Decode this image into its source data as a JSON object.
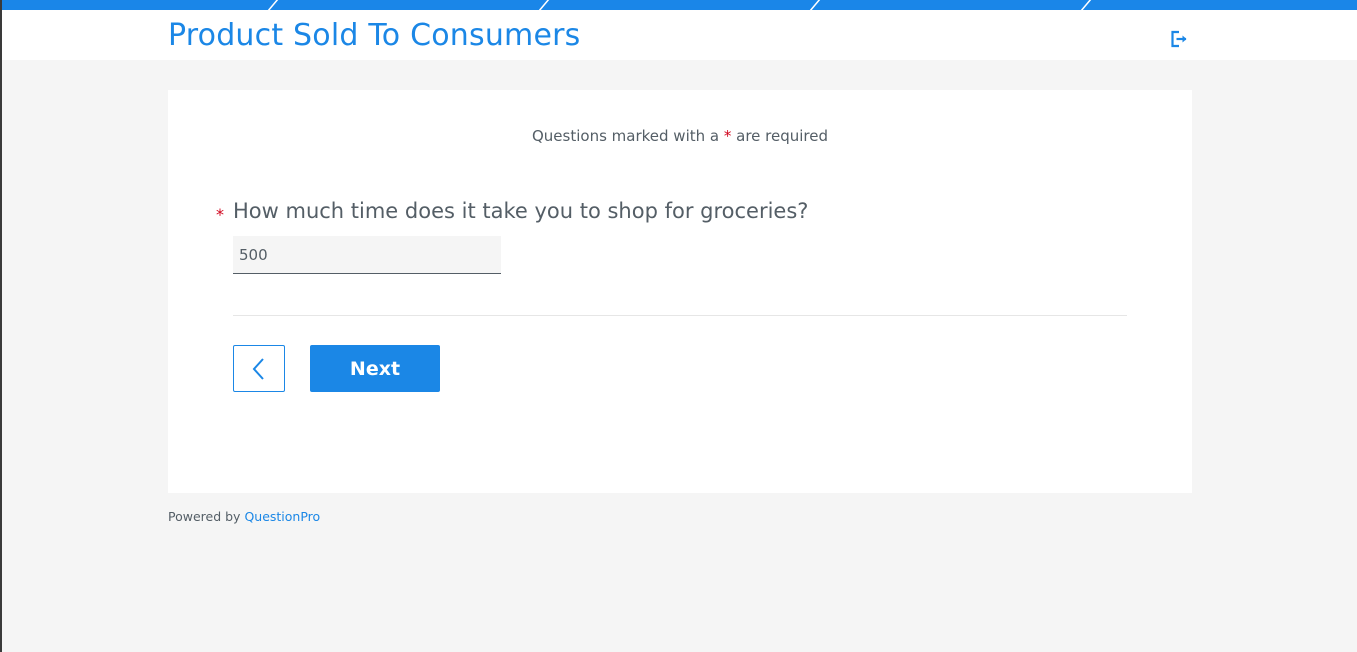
{
  "header": {
    "title": "Product Sold To Consumers",
    "exit_icon": "exit-icon"
  },
  "progress": {
    "segments": 5
  },
  "card": {
    "required_note_prefix": "Questions marked with a ",
    "required_note_star": "*",
    "required_note_suffix": " are required",
    "question": {
      "required_star": "*",
      "text": "How much time does it take you to shop for groceries?",
      "answer_value": "500"
    },
    "back_icon": "chevron-left-icon",
    "next_label": "Next"
  },
  "footer": {
    "powered_by": "Powered by",
    "brand": "QuestionPro"
  },
  "colors": {
    "accent": "#1b87e6",
    "required": "#d0021b",
    "text": "#545e66",
    "background": "#f5f5f5"
  }
}
